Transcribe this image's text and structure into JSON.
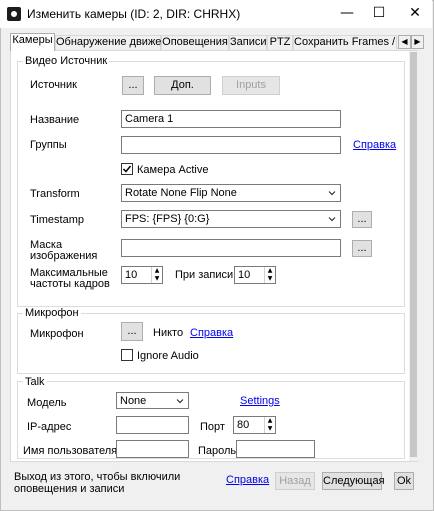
{
  "window": {
    "title": "Изменить камеры (ID: 2, DIR: CHRHX)",
    "minimize": "—",
    "maximize": "☐",
    "close": "✕"
  },
  "tabs": [
    "Камеры",
    "Обнаружение движения",
    "Оповещения",
    "Записи",
    "PTZ",
    "Сохранить Frames / FTP"
  ],
  "tab_scroll": {
    "left": "◀",
    "right": "▶"
  },
  "video_source": {
    "group_label": "Видео Источник",
    "source_label": "Источник",
    "browse_btn": "...",
    "extra_btn": "Доп.",
    "inputs_btn": "Inputs",
    "name_label": "Название",
    "name_value": "Camera 1",
    "groups_label": "Группы",
    "groups_value": "",
    "help_link": "Справка",
    "camera_active_label": "Камера Active",
    "camera_active_checked": true,
    "transform_label": "Transform",
    "transform_value": "Rotate None Flip None",
    "timestamp_label": "Timestamp",
    "timestamp_value": "FPS: {FPS} {0:G}",
    "timestamp_btn": "...",
    "mask_label": "Маска изображения",
    "mask_value": "",
    "mask_btn": "...",
    "maxfps_label": "Максимальные частоты кадров",
    "maxfps_value": "10",
    "record_label": "При записи",
    "record_value": "10"
  },
  "microphone": {
    "group_label": "Микрофон",
    "mic_label": "Микрофон",
    "mic_btn": "...",
    "mic_value": "Никто",
    "help_link": "Справка",
    "ignore_audio_label": "Ignore Audio",
    "ignore_audio_checked": false
  },
  "talk": {
    "group_label": "Talk",
    "model_label": "Модель",
    "model_value": "None",
    "settings_link": "Settings",
    "ip_label": "IP-адрес",
    "ip_value": "",
    "port_label": "Порт",
    "port_value": "80",
    "user_label": "Имя пользователя",
    "user_value": "",
    "password_label": "Пароль",
    "password_value": ""
  },
  "footer": {
    "hint": "Выход из этого, чтобы включили оповещения и записи",
    "help_link": "Справка",
    "back_btn": "Назад",
    "next_btn": "Следующая",
    "ok_btn": "Ok"
  }
}
